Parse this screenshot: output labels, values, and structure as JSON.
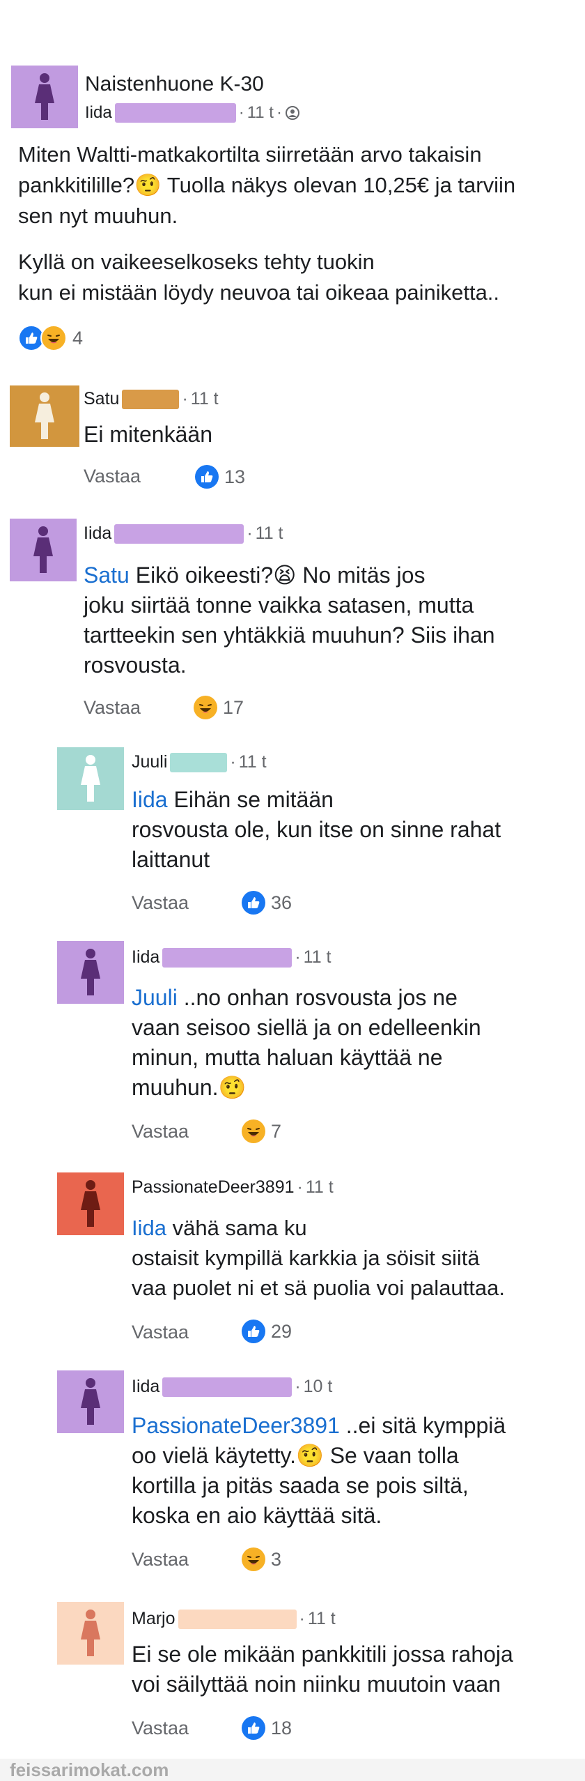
{
  "post": {
    "group": "Naistenhuone K-30",
    "author": "Iida",
    "time": "11 t",
    "text_p1": "Miten Waltti-matkakortilta siirretään arvo takaisin",
    "text_p2_a": "pankkitilille?",
    "text_p2_b": " Tuolla näkys olevan 10,25€ ja tarviin",
    "text_p3": "sen nyt muuhun.",
    "text_p4": "Kyllä on vaikeeselkoseks tehty tuokin",
    "text_p5": "kun ei mistään löydy neuvoa tai oikeaa painiketta..",
    "reaction_count": "4"
  },
  "comments": [
    {
      "author": "Satu",
      "time": "11 t",
      "mention": "",
      "lines": [
        "Ei mitenkään"
      ],
      "reply": "Vastaa",
      "reaction": "like",
      "count": "13",
      "avatar_color": "#d2963e",
      "figure_color": "#f6eedd",
      "bar_color": "#d99a48"
    },
    {
      "author": "Iida",
      "time": "11 t",
      "mention": "Satu",
      "lines": [
        " Eikö oikeesti?😫 No mitäs jos",
        "joku siirtää tonne vaikka satasen, mutta",
        "tartteekin sen yhtäkkiä muuhun? Siis ihan",
        "rosvousta."
      ],
      "reply": "Vastaa",
      "reaction": "haha",
      "count": "17",
      "avatar_color": "#c19be0",
      "figure_color": "#5a2e77",
      "bar_color": "#c8a2e4"
    },
    {
      "author": "Juuli",
      "time": "11 t",
      "mention": "Iida",
      "lines": [
        " Eihän se mitään",
        "rosvousta ole, kun itse on sinne rahat",
        "laittanut"
      ],
      "reply": "Vastaa",
      "reaction": "like",
      "count": "36",
      "avatar_color": "#a4d9d2",
      "figure_color": "#ffffff",
      "bar_color": "#a9dfd8"
    },
    {
      "author": "Iida",
      "time": "11 t",
      "mention": "Juuli",
      "lines": [
        " ..no onhan rosvousta jos ne",
        "vaan seisoo siellä ja on edelleenkin",
        "minun, mutta haluan käyttää ne",
        "muuhun.🤨"
      ],
      "reply": "Vastaa",
      "reaction": "haha",
      "count": "7",
      "avatar_color": "#c19be0",
      "figure_color": "#5a2e77",
      "bar_color": "#c8a2e4"
    },
    {
      "author": "PassionateDeer3891",
      "time": "11 t",
      "mention": "Iida",
      "lines": [
        " vähä sama ku",
        "ostaisit kympillä karkkia ja söisit siitä",
        "vaa puolet ni et sä puolia voi palauttaa."
      ],
      "reply": "Vastaa",
      "reaction": "like",
      "count": "29",
      "avatar_color": "#e9664f",
      "figure_color": "#6e1c14",
      "bar_color": ""
    },
    {
      "author": "Iida",
      "time": "10 t",
      "mention": "PassionateDeer3891",
      "lines": [
        " ..ei sitä kymppiä",
        "oo vielä käytetty.🤨 Se vaan tolla",
        "kortilla ja pitäs saada se pois siltä,",
        "koska en aio käyttää sitä."
      ],
      "reply": "Vastaa",
      "reaction": "haha",
      "count": "3",
      "avatar_color": "#c19be0",
      "figure_color": "#5a2e77",
      "bar_color": "#c8a2e4"
    },
    {
      "author": "Marjo",
      "time": "11 t",
      "mention": "",
      "lines": [
        "Ei se ole mikään pankkitili jossa rahoja",
        "voi säilyttää noin niinku muutoin vaan"
      ],
      "reply": "Vastaa",
      "reaction": "like",
      "count": "18",
      "avatar_color": "#fbd8c0",
      "figure_color": "#d9775e",
      "bar_color": "#fcd9c0"
    }
  ],
  "footer": {
    "watermark": "feissarimokat.com"
  },
  "icons": {
    "like": "thumbs-up-icon",
    "haha": "laughing-face-icon",
    "privacy": "group-privacy-icon",
    "raised_eyebrow": "raised-eyebrow-emoji"
  }
}
